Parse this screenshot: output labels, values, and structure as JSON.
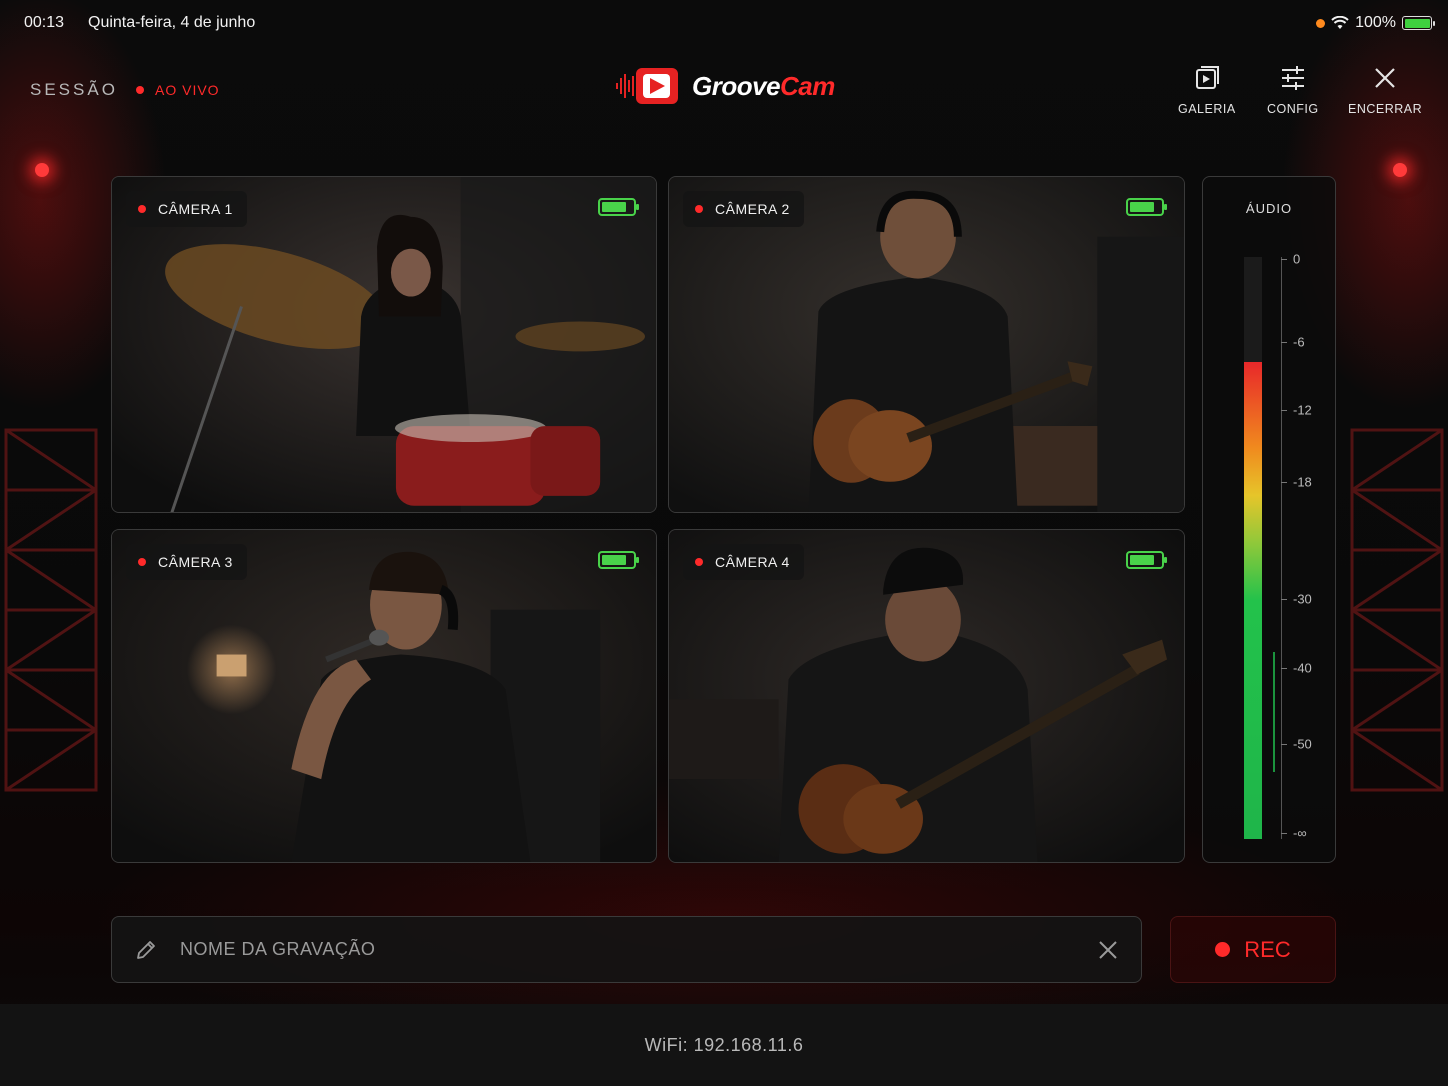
{
  "status_bar": {
    "time": "00:13",
    "date": "Quinta-feira, 4 de junho",
    "battery": "100%",
    "icons": [
      "orange-dot-icon",
      "wifi-icon",
      "battery-charging-icon"
    ]
  },
  "header": {
    "session_label": "SESSÃO",
    "live_label": "AO VIVO",
    "logo": {
      "part1": "Groove",
      "part2": "Cam"
    },
    "buttons": {
      "gallery": "GALERIA",
      "config": "CONFIG",
      "end": "ENCERRAR"
    }
  },
  "cameras": [
    {
      "label": "CÂMERA 1",
      "subject": "drummer",
      "battery_level": 0.8
    },
    {
      "label": "CÂMERA 2",
      "subject": "guitarist",
      "battery_level": 0.8
    },
    {
      "label": "CÂMERA 3",
      "subject": "singer",
      "battery_level": 0.8
    },
    {
      "label": "CÂMERA 4",
      "subject": "bassist",
      "battery_level": 0.8
    }
  ],
  "audio": {
    "title": "ÁUDIO",
    "scale": [
      "0",
      "-6",
      "-12",
      "-18",
      "-30",
      "-40",
      "-50",
      "-∞"
    ],
    "level_fraction": 0.82
  },
  "recording": {
    "name_placeholder": "NOME DA GRAVAÇÃO",
    "name_value": "",
    "rec_label": "REC"
  },
  "footer": {
    "wifi": "WiFi: 192.168.11.6"
  },
  "colors": {
    "accent": "#ff2a2a",
    "battery_ok": "#49d24a",
    "background": "#0a0a0a"
  }
}
